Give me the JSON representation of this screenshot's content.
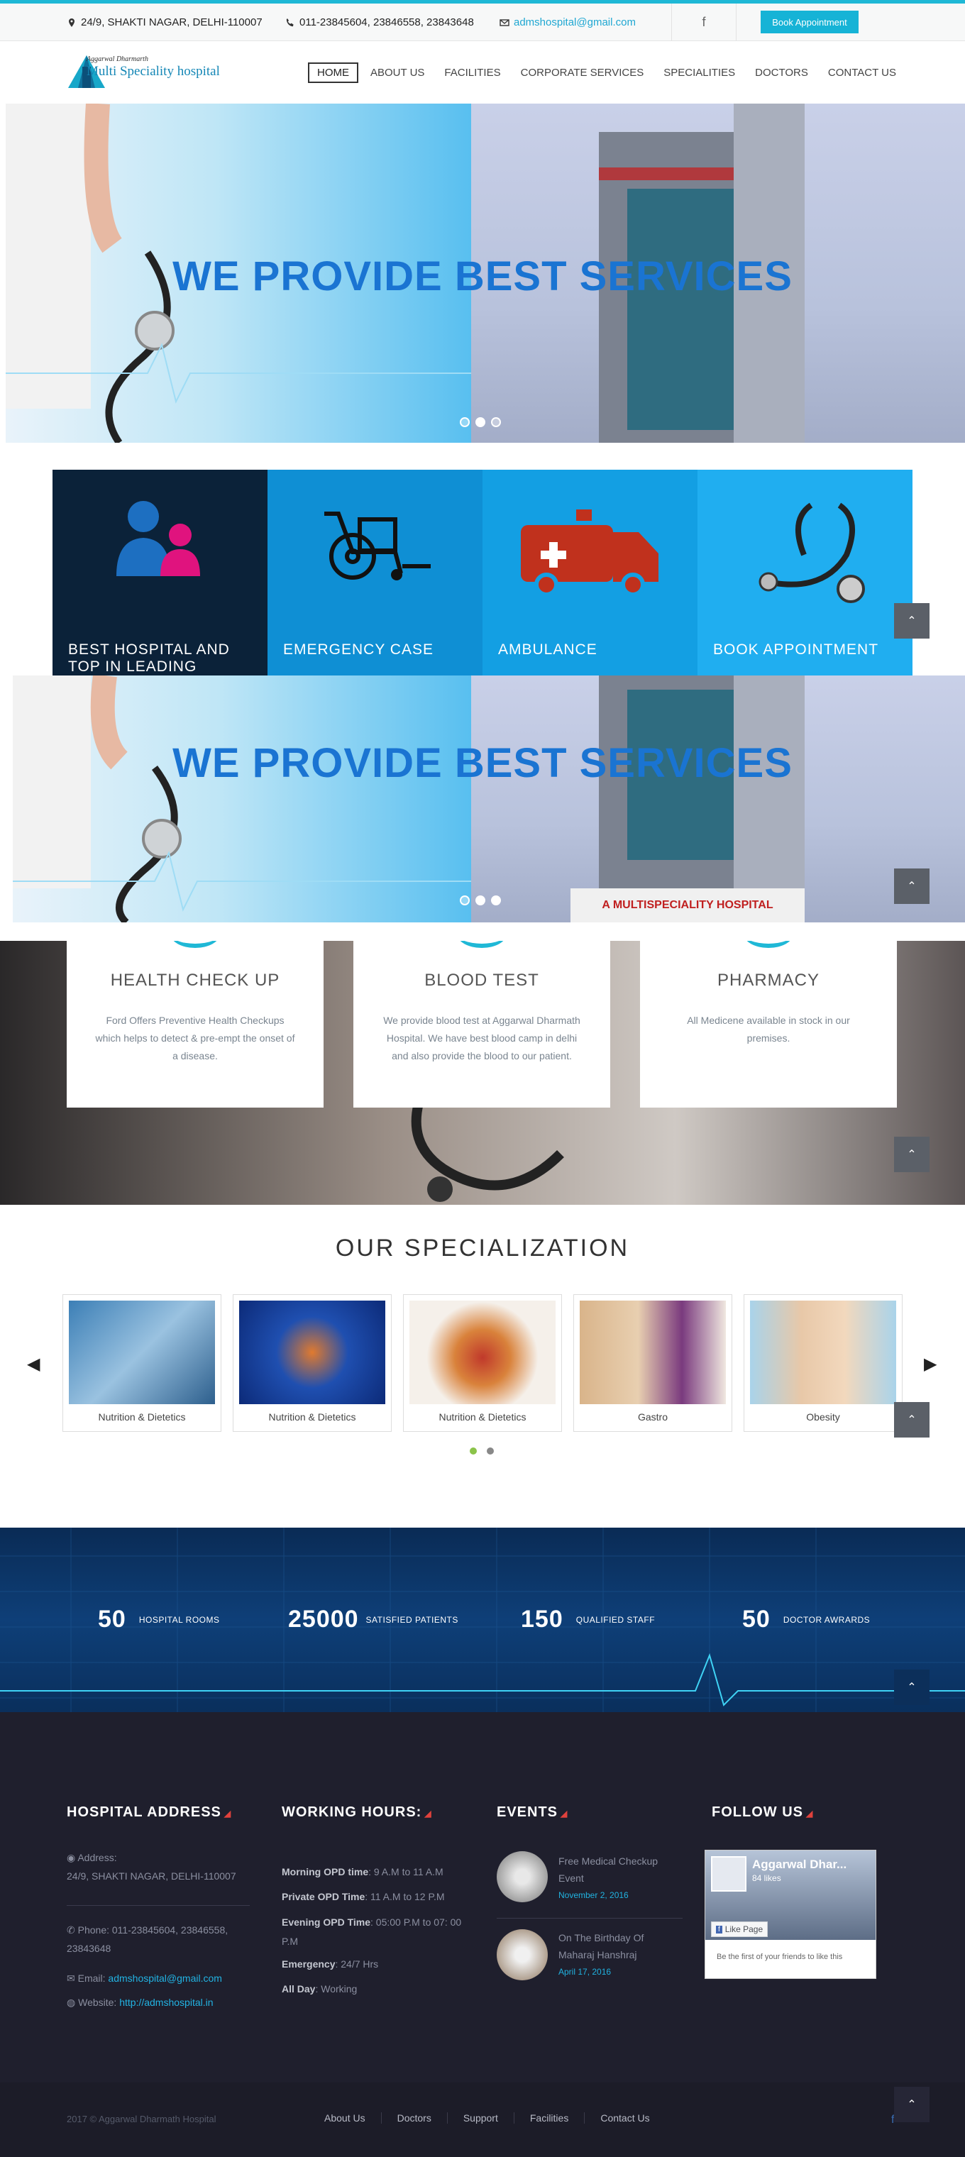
{
  "topbar": {
    "address": "24/9, SHAKTI NAGAR, DELHI-110007",
    "phone": "011-23845604, 23846558, 23843648",
    "email": "admshospital@gmail.com",
    "book_button": "Book Appointment"
  },
  "logo": {
    "line1": "Aggarwal Dharmarth",
    "line2": "Multi Speciality hospital"
  },
  "nav": {
    "items": [
      "HOME",
      "ABOUT US",
      "FACILITIES",
      "CORPORATE SERVICES",
      "SPECIALITIES",
      "DOCTORS",
      "CONTACT US"
    ],
    "active": "HOME"
  },
  "hero": {
    "title": "WE PROVIDE BEST SERVICES",
    "hospital_sign": "A MULTISPECIALITY HOSPITAL"
  },
  "features": [
    {
      "title": "BEST HOSPITAL AND",
      "title2": "TOP IN LEADING",
      "color": "#0b2239"
    },
    {
      "title": "EMERGENCY CASE",
      "color": "#0f8fd4"
    },
    {
      "title": "AMBULANCE",
      "color": "#139fe3"
    },
    {
      "title": "BOOK APPOINTMENT",
      "color": "#20aef0"
    }
  ],
  "services": [
    {
      "title": "HEALTH CHECK UP",
      "text": "Ford Offers Preventive Health Checkups which helps to detect & pre-empt the onset of a disease."
    },
    {
      "title": "BLOOD TEST",
      "text": "We provide blood test at Aggarwal Dharmath Hospital. We have best blood camp in delhi and also provide the blood to our patient."
    },
    {
      "title": "PHARMACY",
      "text": "All Medicene available in stock in our premises."
    }
  ],
  "specialization": {
    "title": "OUR SPECIALIZATION",
    "cards": [
      "Nutrition & Dietetics",
      "Nutrition & Dietetics",
      "Nutrition & Dietetics",
      "Gastro",
      "Obesity"
    ]
  },
  "stats": [
    {
      "num": "50",
      "label": "HOSPITAL ROOMS"
    },
    {
      "num": "25000",
      "label": "SATISFIED PATIENTS"
    },
    {
      "num": "150",
      "label": "QUALIFIED STAFF"
    },
    {
      "num": "50",
      "label": "DOCTOR AWRARDS"
    }
  ],
  "footer": {
    "address_title": "HOSPITAL ADDRESS",
    "address_label": "Address:",
    "address": "24/9, SHAKTI NAGAR, DELHI-110007",
    "phone_label": "Phone: 011-23845604, 23846558,",
    "phone2": "23843648",
    "email_label": "Email:",
    "email": "admshospital@gmail.com",
    "website_label": "Website:",
    "website": "http://admshospital.in",
    "hours_title": "WORKING HOURS:",
    "hours": [
      {
        "k": "Morning OPD time",
        "v": ": 9 A.M to 11 A.M"
      },
      {
        "k": "Private OPD Time",
        "v": ": 11 A.M to 12 P.M"
      },
      {
        "k": "Evening OPD Time",
        "v": ": 05:00 P.M to 07: 00"
      },
      {
        "k": "",
        "v": "P.M"
      },
      {
        "k": "Emergency",
        "v": ": 24/7 Hrs"
      },
      {
        "k": "All Day",
        "v": ": Working"
      }
    ],
    "events_title": "EVENTS",
    "events": [
      {
        "title1": "Free Medical Checkup",
        "title2": "Event",
        "date": "November 2, 2016"
      },
      {
        "title1": "On The Birthday Of",
        "title2": "Maharaj Hanshraj",
        "date": "April 17, 2016"
      }
    ],
    "follow_title": "FOLLOW US",
    "fb_page": "Aggarwal Dhar...",
    "fb_likes": "84 likes",
    "fb_like_btn": "Like Page",
    "fb_first": "Be the first of your friends to like this"
  },
  "bottom": {
    "copyright": "2017 © Aggarwal Dharmath Hospital",
    "links": [
      "About Us",
      "Doctors",
      "Support",
      "Facilities",
      "Contact Us"
    ]
  }
}
